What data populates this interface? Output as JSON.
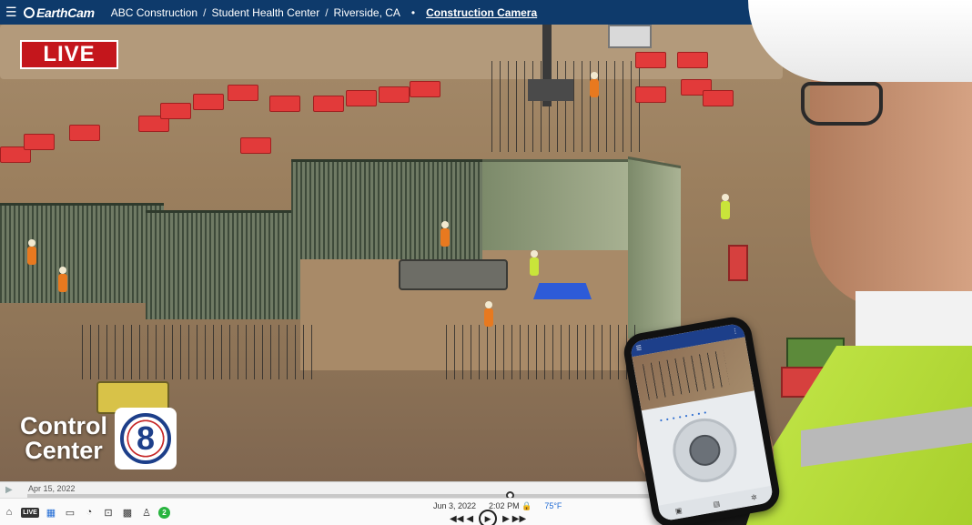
{
  "header": {
    "menu_icon": "hamburger-menu-icon",
    "logo": "EarthCam",
    "breadcrumbs": [
      "ABC Construction",
      "Student Health Center",
      "Riverside, CA"
    ],
    "separator": "/",
    "bullet": "•",
    "camera_link": "Construction Camera"
  },
  "overlay": {
    "live_badge": "LIVE",
    "control_center_line1": "Control",
    "control_center_line2": "Center",
    "control_center_badge": "8"
  },
  "timeline": {
    "start_date": "Apr 15, 2022",
    "position": 0.77
  },
  "toolbar": {
    "icons": [
      "home-icon",
      "live-icon",
      "film-icon",
      "panorama-icon",
      "gauge-icon",
      "camera-view-icon",
      "grid-icon",
      "pin-icon",
      "status-icon"
    ],
    "live_label": "LIVE",
    "status_count": "2",
    "date": "Jun 3, 2022",
    "time": "2:02 PM",
    "lock_icon": "lock-icon",
    "temperature": "75°F",
    "controls": {
      "skip_back": "◀◀",
      "step_back": "◀",
      "play": "▶",
      "step_forward": "▶",
      "skip_forward": "▶▶"
    }
  },
  "colors": {
    "header_bg": "#0e3a6b",
    "live_red": "#c4161c",
    "accent_blue": "#1f6ad4",
    "status_green": "#28b43f"
  }
}
